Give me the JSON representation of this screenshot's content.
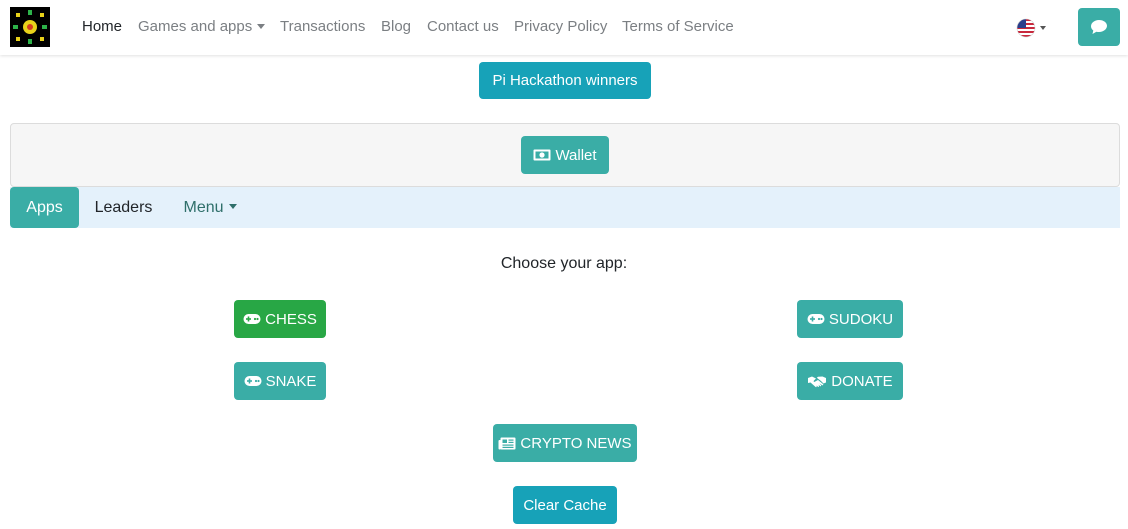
{
  "navbar": {
    "logo_alt": "logo",
    "links": {
      "home": "Home",
      "games": "Games and apps",
      "transactions": "Transactions",
      "blog": "Blog",
      "contact": "Contact us",
      "privacy": "Privacy Policy",
      "terms": "Terms of Service"
    },
    "language_icon": "us-flag-icon",
    "chat_icon": "chat-icon"
  },
  "banner": {
    "hackathon_label": "Pi Hackathon winners"
  },
  "wallet": {
    "label": "Wallet",
    "icon": "money-bill-icon"
  },
  "tabs": {
    "apps": "Apps",
    "leaders": "Leaders",
    "menu": "Menu"
  },
  "main": {
    "prompt": "Choose your app:",
    "apps": {
      "chess": "CHESS",
      "sudoku": "SUDOKU",
      "snake": "SNAKE",
      "donate": "DONATE",
      "crypto_news": "CRYPTO NEWS"
    },
    "clear_cache": "Clear Cache"
  },
  "colors": {
    "teal": "#3aada6",
    "info": "#17a2b8",
    "green": "#28a745",
    "tabs_bg": "#e4f1fb"
  }
}
